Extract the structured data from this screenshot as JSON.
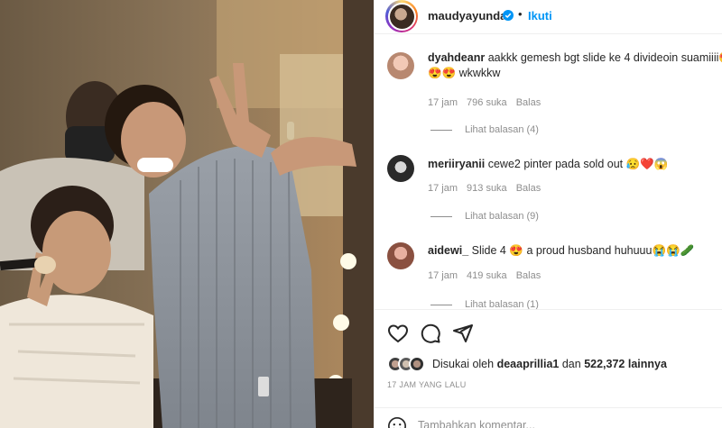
{
  "post": {
    "username": "maudyayunda",
    "separator": "•",
    "follow_label": "Ikuti"
  },
  "comments": [
    {
      "username": "dyahdeanr",
      "text": "aakkk gemesh bgt slide ke 4 divideoin suamiiii",
      "text_line2": "wkwkkw",
      "time": "17 jam",
      "likes": "796 suka",
      "reply_label": "Balas",
      "view_replies": "Lihat balasan (4)"
    },
    {
      "username": "meriiryanii",
      "text": "cewe2 pinter pada sold out",
      "time": "17 jam",
      "likes": "913 suka",
      "reply_label": "Balas",
      "view_replies": "Lihat balasan (9)"
    },
    {
      "username": "aidewi_",
      "text_before": "Slide 4",
      "text_after": "a proud husband huhuuu",
      "time": "17 jam",
      "likes": "419 suka",
      "reply_label": "Balas",
      "view_replies": "Lihat balasan (1)"
    }
  ],
  "likes": {
    "prefix": "Disukai oleh",
    "user": "deaaprillia1",
    "middle": "dan",
    "count": "522,372 lainnya"
  },
  "timeago": "17 JAM YANG LALU",
  "add_comment": {
    "placeholder": "Tambahkan komentar..."
  },
  "colors": {
    "accent": "#0095f6",
    "text": "#262626",
    "muted": "#8e8e8e",
    "divider": "#efefef"
  },
  "icons": {
    "like": "heart-icon",
    "comment": "comment-icon",
    "share": "share-icon",
    "verified": "verified-badge-icon",
    "emoji": "emoji-icon"
  }
}
